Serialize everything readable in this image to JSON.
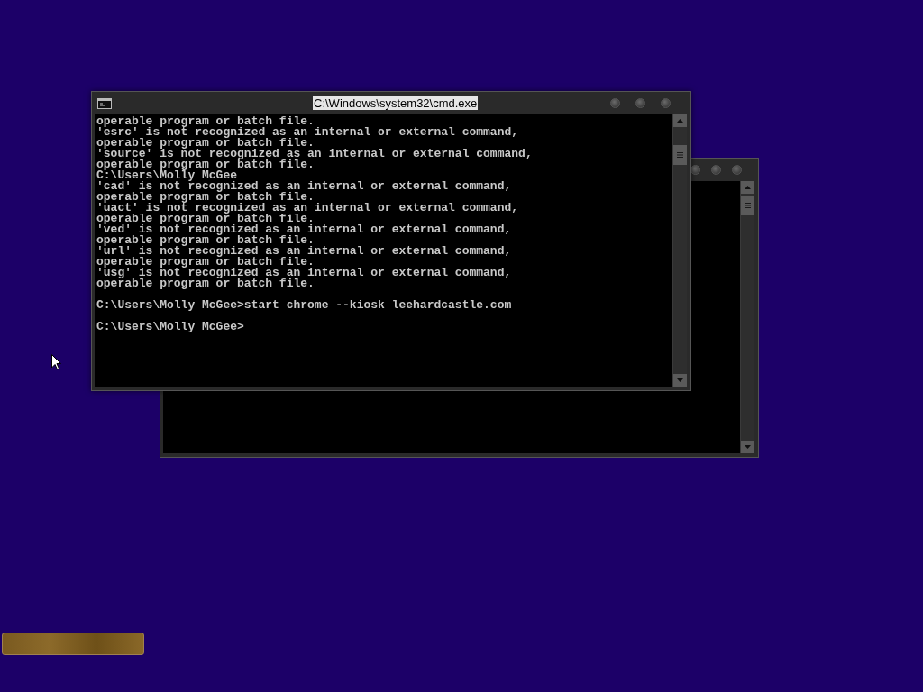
{
  "back_window": {
    "kind": "console"
  },
  "front_window": {
    "title": "C:\\Windows\\system32\\cmd.exe",
    "blocks": [
      {
        "lines": [
          "operable program or batch file.",
          "'esrc' is not recognized as an internal or external command,",
          "operable program or batch file.",
          "'source' is not recognized as an internal or external command,",
          "operable program or batch file.",
          "C:\\Users\\Molly McGee",
          "'cad' is not recognized as an internal or external command,",
          "operable program or batch file.",
          "'uact' is not recognized as an internal or external command,",
          "operable program or batch file.",
          "'ved' is not recognized as an internal or external command,",
          "operable program or batch file.",
          "'url' is not recognized as an internal or external command,",
          "operable program or batch file.",
          "'usg' is not recognized as an internal or external command,",
          "operable program or batch file."
        ]
      },
      {
        "lines": [
          "C:\\Users\\Molly McGee>start chrome --kiosk leehardcastle.com"
        ]
      },
      {
        "lines": [
          "C:\\Users\\Molly McGee>"
        ]
      }
    ]
  }
}
